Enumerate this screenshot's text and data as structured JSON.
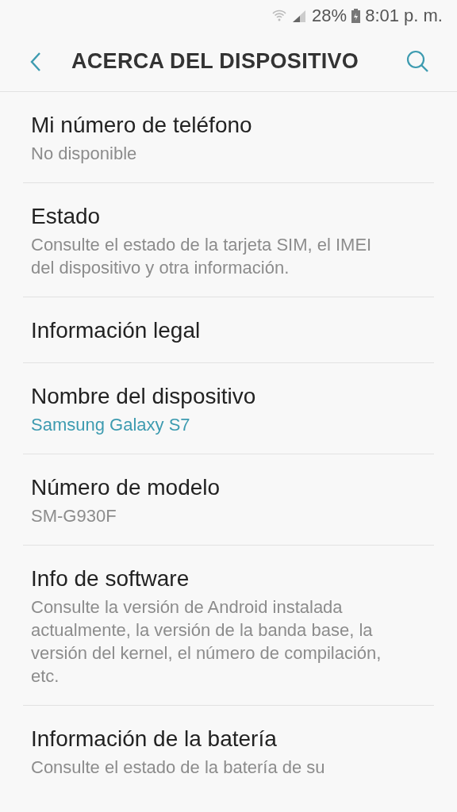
{
  "status_bar": {
    "battery": "28%",
    "time": "8:01 p. m."
  },
  "header": {
    "title": "ACERCA DEL DISPOSITIVO"
  },
  "items": [
    {
      "title": "Mi número de teléfono",
      "summary": "No disponible",
      "accent": false
    },
    {
      "title": "Estado",
      "summary": "Consulte el estado de la tarjeta SIM, el IMEI del dispositivo y otra información.",
      "accent": false
    },
    {
      "title": "Información legal"
    },
    {
      "title": "Nombre del dispositivo",
      "summary": "Samsung Galaxy S7",
      "accent": true
    },
    {
      "title": "Número de modelo",
      "summary": "SM-G930F",
      "accent": false
    },
    {
      "title": "Info de software",
      "summary": "Consulte la versión de Android instalada actualmente, la versión de la banda base, la versión del kernel, el número de compilación, etc.",
      "accent": false
    },
    {
      "title": "Información de la batería",
      "summary": "Consulte el estado de la batería de su",
      "accent": false
    }
  ]
}
